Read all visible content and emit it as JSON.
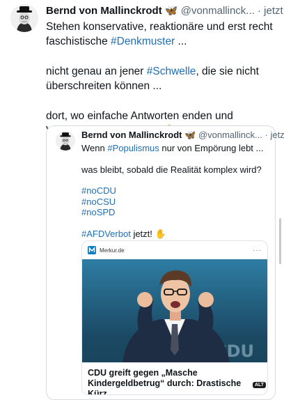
{
  "post": {
    "author_name": "Bernd von Mallinckrodt",
    "verified_emoji": "🦋",
    "handle": "@vonmallinck...",
    "separator": "·",
    "time": "jetzt",
    "p1_a": "Stehen konservative, reaktionäre und erst recht faschistische ",
    "p1_tag": "#Denkmuster",
    "p1_b": " ...",
    "p2_a": "nicht genau an jener ",
    "p2_tag": "#Schwelle",
    "p2_b": ", die sie nicht überschreiten können ...",
    "p3": "dort, wo einfache Antworten enden und Verantwortung beginnt? ✋"
  },
  "quote": {
    "author_name": "Bernd von Mallinckrodt",
    "verified_emoji": "🦋",
    "handle": "@vonmallinck...",
    "separator": "·",
    "time": "jetzt",
    "l1_a": "Wenn ",
    "l1_tag": "#Populismus",
    "l1_b": " nur von Empörung lebt ...",
    "l2": "was bleibt, sobald die Realität komplex wird?",
    "tags": [
      "#noCDU",
      "#noCSU",
      "#noSPD"
    ],
    "l4_tag": "#AFDVerbot",
    "l4_b": " jetzt! ✋"
  },
  "card": {
    "source": "Merkur.de",
    "more": "···",
    "title": "CDU greift gegen „Masche Kindergeldbetrug“ durch: Drastische Kürz...",
    "alt_badge": "ALT",
    "photo_watermark": "CDU"
  },
  "colors": {
    "link": "#1d6fb8",
    "muted": "#536471"
  }
}
